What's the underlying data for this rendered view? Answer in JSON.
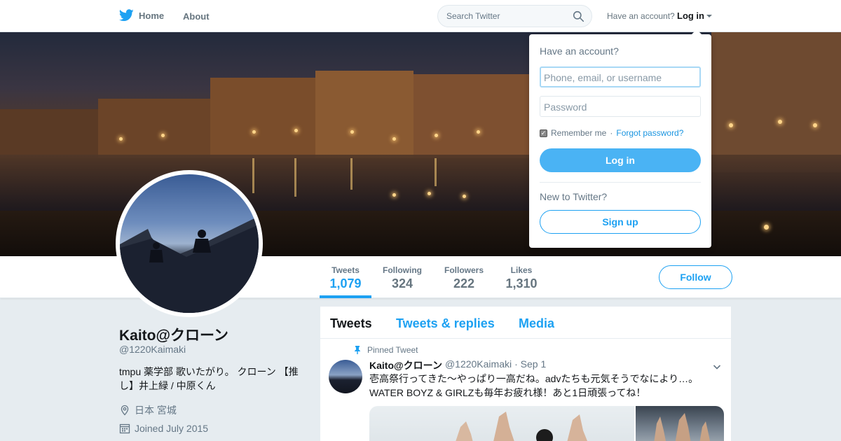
{
  "nav": {
    "home_label": "Home",
    "about_label": "About",
    "search_placeholder": "Search Twitter",
    "have_account": "Have an account?",
    "login_label": "Log in"
  },
  "profile": {
    "name": "Kaito@クローン",
    "handle": "@1220Kaimaki",
    "bio": "tmpu 薬学部 歌いたがり。 クローン 【推し】井上緑 / 中原くん",
    "location": "日本 宮城",
    "joined": "Joined July 2015"
  },
  "stats": [
    {
      "label": "Tweets",
      "value": "1,079",
      "active": true
    },
    {
      "label": "Following",
      "value": "324",
      "active": false
    },
    {
      "label": "Followers",
      "value": "222",
      "active": false
    },
    {
      "label": "Likes",
      "value": "1,310",
      "active": false
    }
  ],
  "follow_label": "Follow",
  "timeline": {
    "tabs": [
      "Tweets",
      "Tweets & replies",
      "Media"
    ],
    "pinned_label": "Pinned Tweet",
    "tweet": {
      "name": "Kaito@クローン",
      "handle": "@1220Kaimaki",
      "date": "· Sep 1",
      "text": "壱高祭行ってきた～やっぱり一高だね。advたちも元気そうでなにより…。WATER BOYZ & GIRLZも毎年お疲れ様！あと1日頑張ってね！"
    }
  },
  "login_dropdown": {
    "title": "Have an account?",
    "username_placeholder": "Phone, email, or username",
    "password_placeholder": "Password",
    "remember_me": "Remember me",
    "separator": "·",
    "forgot_password": "Forgot password?",
    "login_button": "Log in",
    "new_to_twitter": "New to Twitter?",
    "signup_button": "Sign up"
  },
  "colors": {
    "accent": "#1da1f2",
    "login_button_bg": "#4ab3f4",
    "page_bg": "#e6ecf0"
  },
  "icons": [
    "twitter-bird-icon",
    "search-icon",
    "location-pin-icon",
    "calendar-icon",
    "pin-icon",
    "chevron-down-icon"
  ]
}
